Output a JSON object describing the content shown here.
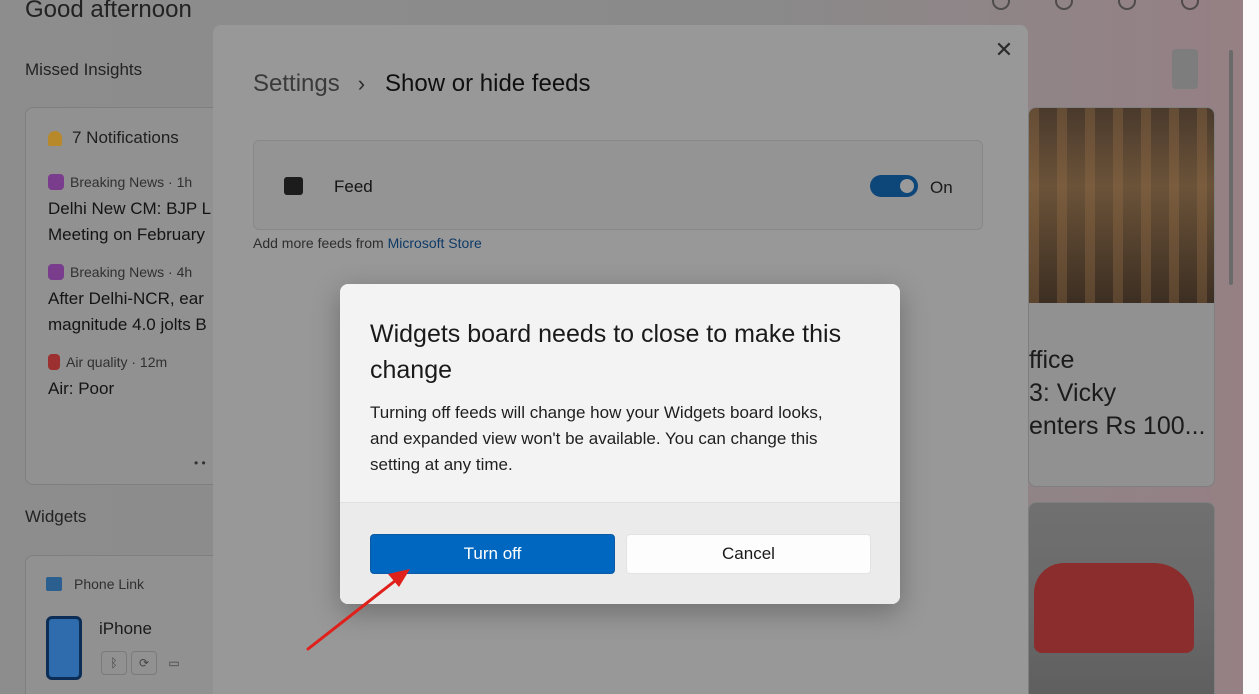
{
  "board": {
    "greeting": "Good afternoon",
    "missed_insights_heading": "Missed Insights",
    "notifications": {
      "title": "7 Notifications",
      "items": [
        {
          "source": "Breaking News · 1h",
          "title": "Delhi New CM: BJP L\nMeeting on February"
        },
        {
          "source": "Breaking News · 4h",
          "title": "After Delhi-NCR, ear\nmagnitude 4.0 jolts B"
        },
        {
          "source": "Air quality · 12m",
          "title": "Air: Poor"
        }
      ],
      "pager": "• •"
    },
    "widgets_heading": "Widgets",
    "phone_link": {
      "app_name": "Phone Link",
      "device_name": "iPhone",
      "icons": [
        "bluetooth-icon",
        "sync-icon",
        "battery-icon"
      ]
    },
    "right_story_text": "ffice\n3: Vicky\nenters Rs 100..."
  },
  "settings": {
    "breadcrumb_root": "Settings",
    "breadcrumb_separator": "›",
    "breadcrumb_current": "Show or hide feeds",
    "close_glyph": "✕",
    "feed_row": {
      "label": "Feed",
      "toggle_state": "On",
      "toggle_on": true
    },
    "more_feeds_prefix": "Add more feeds from ",
    "more_feeds_link": "Microsoft Store"
  },
  "dialog": {
    "title": "Widgets board needs to close to make this change",
    "body": "Turning off feeds will change how your Widgets board looks, and expanded view won't be available. You can change this setting at any time.",
    "primary_button": "Turn off",
    "secondary_button": "Cancel"
  },
  "colors": {
    "accent": "#0067c0",
    "toggle_on": "#0d4679",
    "annotation_arrow": "#e0201b"
  }
}
